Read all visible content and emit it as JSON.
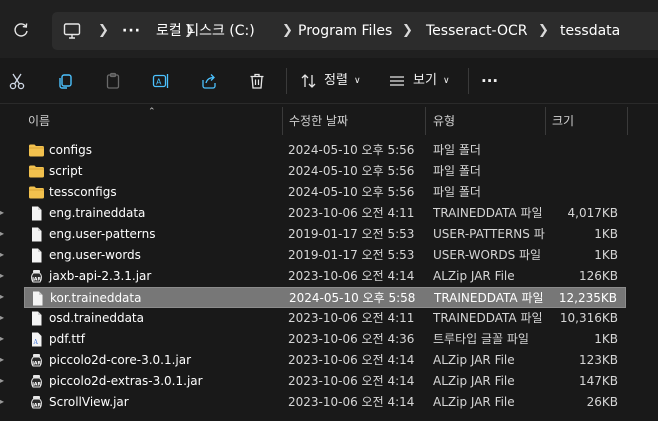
{
  "address_bar": {
    "crumbs": [
      "로컬 디스크 (C:)",
      "Program Files",
      "Tesseract-OCR",
      "tessdata"
    ],
    "overflow": "···"
  },
  "toolbar": {
    "sort_label": "정렬",
    "view_label": "보기",
    "more_label": "···"
  },
  "columns": {
    "name": "이름",
    "modified": "수정한 날짜",
    "type": "유형",
    "size": "크기"
  },
  "files": [
    {
      "name": "configs",
      "modified": "2024-05-10 오후 5:56",
      "type": "파일 폴더",
      "size": "",
      "icon": "folder-icon"
    },
    {
      "name": "script",
      "modified": "2024-05-10 오후 5:56",
      "type": "파일 폴더",
      "size": "",
      "icon": "folder-icon"
    },
    {
      "name": "tessconfigs",
      "modified": "2024-05-10 오후 5:56",
      "type": "파일 폴더",
      "size": "",
      "icon": "folder-icon"
    },
    {
      "name": "eng.traineddata",
      "modified": "2023-10-06 오전 4:11",
      "type": "TRAINEDDATA 파일",
      "size": "4,017KB",
      "icon": "file-icon"
    },
    {
      "name": "eng.user-patterns",
      "modified": "2019-01-17 오전 5:53",
      "type": "USER-PATTERNS 파일",
      "size": "1KB",
      "icon": "file-icon"
    },
    {
      "name": "eng.user-words",
      "modified": "2019-01-17 오전 5:53",
      "type": "USER-WORDS 파일",
      "size": "1KB",
      "icon": "file-icon"
    },
    {
      "name": "jaxb-api-2.3.1.jar",
      "modified": "2023-10-06 오전 4:14",
      "type": "ALZip JAR File",
      "size": "126KB",
      "icon": "jar-icon"
    },
    {
      "name": "kor.traineddata",
      "modified": "2024-05-10 오후 5:58",
      "type": "TRAINEDDATA 파일",
      "size": "12,235KB",
      "icon": "file-icon",
      "selected": true
    },
    {
      "name": "osd.traineddata",
      "modified": "2023-10-06 오전 4:11",
      "type": "TRAINEDDATA 파일",
      "size": "10,316KB",
      "icon": "file-icon"
    },
    {
      "name": "pdf.ttf",
      "modified": "2023-10-06 오전 4:36",
      "type": "트루타입 글꼴 파일",
      "size": "1KB",
      "icon": "font-file-icon"
    },
    {
      "name": "piccolo2d-core-3.0.1.jar",
      "modified": "2023-10-06 오전 4:14",
      "type": "ALZip JAR File",
      "size": "123KB",
      "icon": "jar-icon"
    },
    {
      "name": "piccolo2d-extras-3.0.1.jar",
      "modified": "2023-10-06 오전 4:14",
      "type": "ALZip JAR File",
      "size": "147KB",
      "icon": "jar-icon"
    },
    {
      "name": "ScrollView.jar",
      "modified": "2023-10-06 오전 4:14",
      "type": "ALZip JAR File",
      "size": "26KB",
      "icon": "jar-icon"
    }
  ],
  "colors": {
    "background": "#191919",
    "selected_row": "#777777",
    "folder": "#f2c14e",
    "accent_blue": "#4cc2ff"
  }
}
